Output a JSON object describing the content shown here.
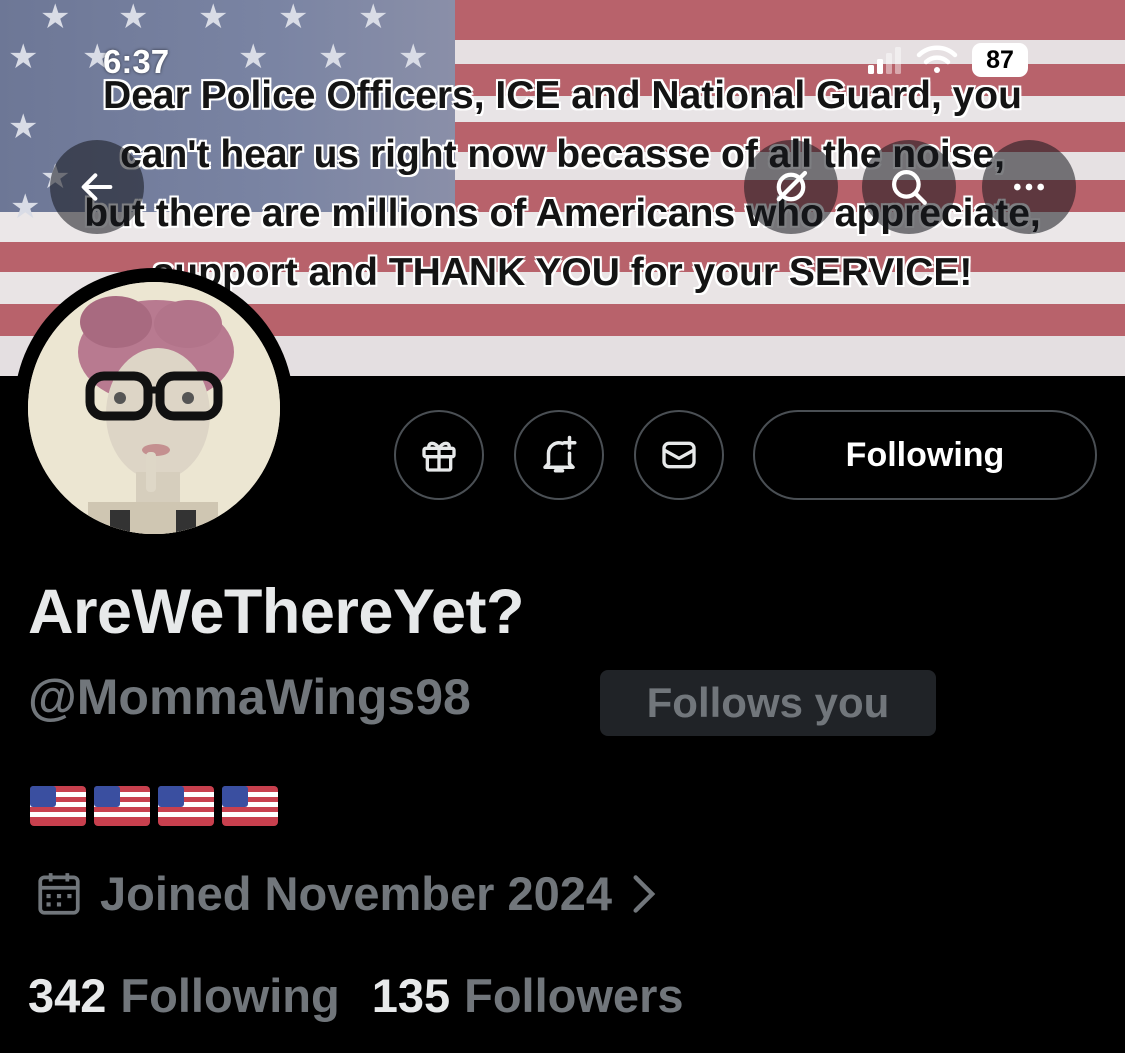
{
  "status_bar": {
    "time": "6:37",
    "battery": "87"
  },
  "banner": {
    "lines": [
      "Dear Police Officers, ICE and National Guard, you",
      "can't hear us right now becasse of all the noise,",
      "but there are millions of Americans who appreciate,",
      "support and THANK YOU for your SERVICE!"
    ]
  },
  "header_icons": {
    "back": "arrow-left-icon",
    "grok": "grok-icon",
    "search": "search-icon",
    "more": "more-icon"
  },
  "actions": {
    "gift_icon": "gift-icon",
    "notify_icon": "bell-plus-icon",
    "message_icon": "envelope-icon",
    "follow_label": "Following"
  },
  "profile": {
    "display_name": "AreWeThereYet?",
    "handle": "@MommaWings98",
    "follows_you": "Follows you",
    "bio": "🇺🇸🇺🇸🇺🇸🇺🇸",
    "joined": "Joined November 2024",
    "following_count": "342",
    "following_label": "Following",
    "followers_count": "135",
    "followers_label": "Followers"
  },
  "colors": {
    "background": "#000000",
    "muted": "#71767b",
    "text": "#e7e9ea"
  }
}
